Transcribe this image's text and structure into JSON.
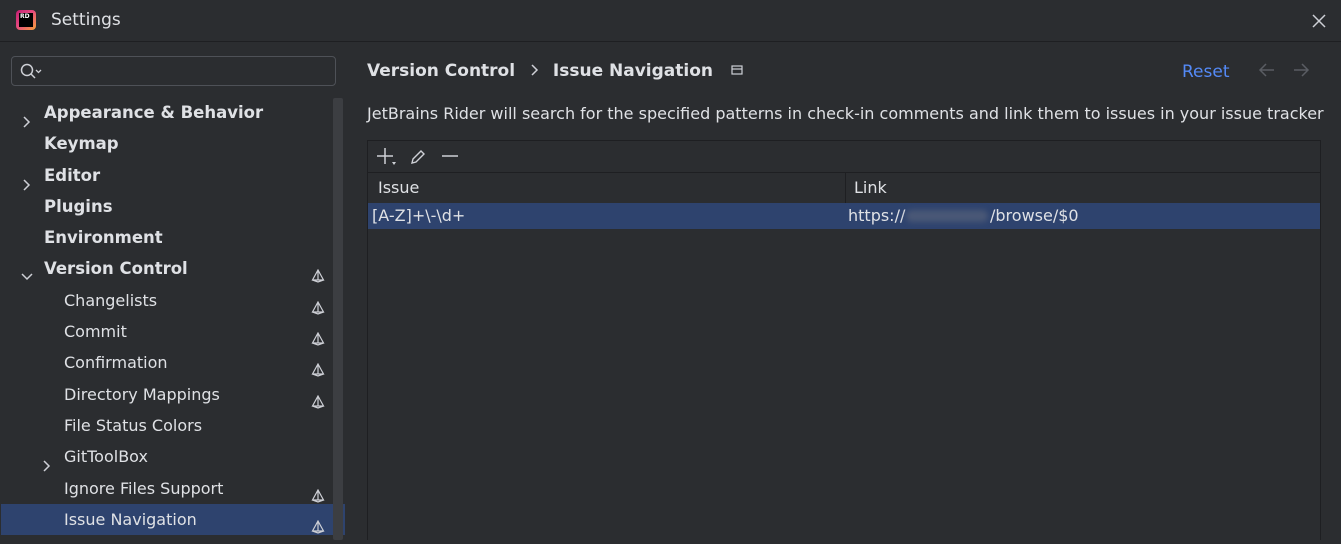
{
  "window": {
    "title": "Settings",
    "app_icon_text": "RD"
  },
  "search": {
    "value": "",
    "placeholder": ""
  },
  "tree": {
    "items": [
      {
        "label": "Appearance & Behavior",
        "level": 0,
        "chevron": "right",
        "project_icon": false
      },
      {
        "label": "Keymap",
        "level": 0,
        "chevron": "none",
        "project_icon": false
      },
      {
        "label": "Editor",
        "level": 0,
        "chevron": "right",
        "project_icon": false
      },
      {
        "label": "Plugins",
        "level": 0,
        "chevron": "none",
        "project_icon": false
      },
      {
        "label": "Environment",
        "level": 0,
        "chevron": "none",
        "project_icon": false
      },
      {
        "label": "Version Control",
        "level": 0,
        "chevron": "down",
        "project_icon": true
      },
      {
        "label": "Changelists",
        "level": 1,
        "chevron": "none",
        "project_icon": true
      },
      {
        "label": "Commit",
        "level": 1,
        "chevron": "none",
        "project_icon": true
      },
      {
        "label": "Confirmation",
        "level": 1,
        "chevron": "none",
        "project_icon": true
      },
      {
        "label": "Directory Mappings",
        "level": 1,
        "chevron": "none",
        "project_icon": true
      },
      {
        "label": "File Status Colors",
        "level": 1,
        "chevron": "none",
        "project_icon": false
      },
      {
        "label": "GitToolBox",
        "level": 1,
        "chevron": "right",
        "project_icon": false
      },
      {
        "label": "Ignore Files Support",
        "level": 1,
        "chevron": "none",
        "project_icon": true
      },
      {
        "label": "Issue Navigation",
        "level": 1,
        "chevron": "none",
        "project_icon": true,
        "selected": true
      }
    ]
  },
  "breadcrumb": {
    "parent": "Version Control",
    "current": "Issue Navigation"
  },
  "actions": {
    "reset_label": "Reset"
  },
  "description": "JetBrains Rider will search for the specified patterns in check-in comments and link them to issues in your issue tracker",
  "table": {
    "columns": [
      "Issue",
      "Link"
    ],
    "rows": [
      {
        "issue": "[A-Z]+\\-\\d+",
        "link_prefix": "https://",
        "link_suffix": "/browse/$0"
      }
    ]
  },
  "colors": {
    "accent": "#548af7",
    "selection": "#2e436e",
    "background": "#2b2d30"
  }
}
